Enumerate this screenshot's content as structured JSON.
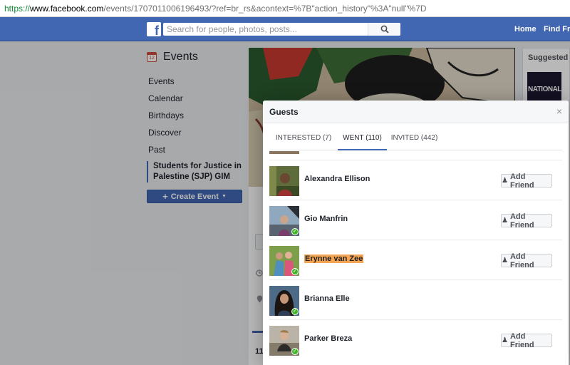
{
  "browser": {
    "url_scheme": "https://",
    "url_host": "www.facebook.com",
    "url_rest": "/events/1707011006196493/?ref=br_rs&acontext=%7B\"action_history\"%3A\"null\"%7D"
  },
  "header": {
    "logo": "f",
    "search_placeholder": "Search for people, photos, posts...",
    "nav": [
      "Home",
      "Find Frie"
    ]
  },
  "sidebar": {
    "title": "Events",
    "calendar_day": "12",
    "items": [
      "Events",
      "Calendar",
      "Birthdays",
      "Discover",
      "Past"
    ],
    "selected_event": "Students for Justice in Palestine (SJP) GIM",
    "create_label": "Create Event"
  },
  "right_rail": {
    "title": "Suggested Ev",
    "promo_text": "NATIONAL"
  },
  "background_peek": {
    "count_fragment": "11"
  },
  "modal": {
    "title": "Guests",
    "close": "×",
    "tabs": [
      {
        "label": "INTERESTED (7)",
        "active": false
      },
      {
        "label": "WENT (110)",
        "active": true
      },
      {
        "label": "INVITED (442)",
        "active": false
      }
    ],
    "add_friend_label": "Add Friend",
    "guests": [
      {
        "name": "Alexandra Ellison",
        "verified": false,
        "highlighted": false,
        "add_friend": true
      },
      {
        "name": "Gio Manfrin",
        "verified": true,
        "highlighted": false,
        "add_friend": true
      },
      {
        "name": "Erynne van Zee",
        "verified": true,
        "highlighted": true,
        "add_friend": true
      },
      {
        "name": "Brianna Elle",
        "verified": true,
        "highlighted": false,
        "add_friend": false
      },
      {
        "name": "Parker Breza",
        "verified": true,
        "highlighted": false,
        "add_friend": true
      }
    ]
  },
  "colors": {
    "brand_blue": "#4267b2",
    "highlight": "#f5a452",
    "check_green": "#42b72a"
  }
}
